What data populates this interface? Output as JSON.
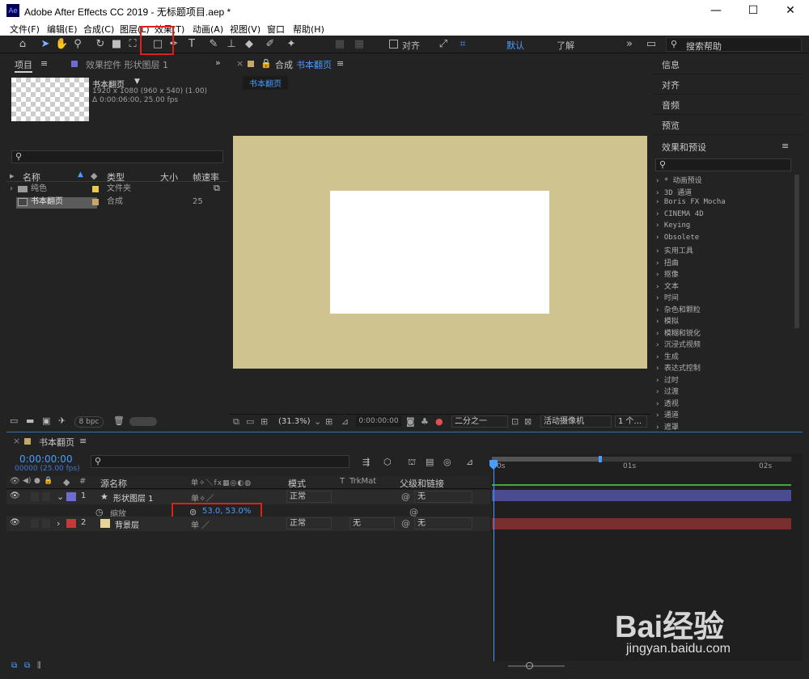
{
  "window": {
    "title": "Adobe After Effects CC 2019 - 无标题项目.aep *",
    "app_logo": "Ae",
    "minimize": "—",
    "maximize": "☐",
    "close": "✕"
  },
  "menu": [
    "文件(F)",
    "编辑(E)",
    "合成(C)",
    "图层(L)",
    "效果(T)",
    "动画(A)",
    "视图(V)",
    "窗口",
    "帮助(H)"
  ],
  "toolbar": {
    "snap_label": "对齐",
    "workspace_default": "默认",
    "workspace_learn": "了解",
    "search_placeholder": "搜索帮助"
  },
  "project": {
    "tab": "项目",
    "effects_tab": "效果控件 形状图层 1",
    "comp_name": "书本翻页",
    "comp_res": "1920 x 1080 (960 x 540) (1.00)",
    "comp_dur": "Δ 0:00:06:00, 25.00 fps",
    "search_placeholder": "",
    "headers": {
      "name": "名称",
      "type": "类型",
      "size": "大小",
      "fps": "帧速率"
    },
    "items": [
      {
        "name": "纯色",
        "type": "文件夹",
        "fps": "",
        "color": "#e6c84a"
      },
      {
        "name": "书本翻页",
        "type": "合成",
        "fps": "25",
        "color": "#c4a96b"
      }
    ],
    "bpc": "8 bpc"
  },
  "composition": {
    "tab": "合成",
    "tab_name": "书本翻页",
    "crumb": "书本翻页",
    "bg_color": "#cfc38f",
    "zoom": "(31.3%)",
    "timecode": "0:00:00:00",
    "resolution": "二分之一",
    "camera": "活动摄像机",
    "views": "1 个..."
  },
  "right": {
    "panels": [
      "信息",
      "对齐",
      "音频",
      "预览"
    ],
    "effects_title": "效果和预设",
    "effects": [
      "* 动画预设",
      "3D 通道",
      "Boris FX Mocha",
      "CINEMA 4D",
      "Keying",
      "Obsolete",
      "实用工具",
      "扭曲",
      "抠像",
      "文本",
      "时间",
      "杂色和颗粒",
      "模拟",
      "模糊和锐化",
      "沉浸式视频",
      "生成",
      "表达式控制",
      "过时",
      "过渡",
      "透视",
      "通道",
      "遮罩"
    ]
  },
  "timeline": {
    "tab": "书本翻页",
    "timecode": "0:00:00:00",
    "frames": "00000 (25.00 fps)",
    "headers": {
      "num": "#",
      "source": "源名称",
      "mode": "模式",
      "t": "T",
      "trkmat": "TrkMat",
      "parent": "父级和链接"
    },
    "ruler": [
      "0s",
      "01s",
      "02s"
    ],
    "layers": [
      {
        "num": "1",
        "name": "形状图层 1",
        "mode": "正常",
        "trkmat": "",
        "parent": "无",
        "color": "#6d6dd1"
      },
      {
        "num": "2",
        "name": "背景层",
        "mode": "正常",
        "trkmat": "无",
        "parent": "无",
        "color": "#c23a3a"
      }
    ],
    "scale_label": "缩放",
    "scale_value": "53.0, 53.0%"
  },
  "watermark": {
    "brand": "Bai经验",
    "url": "jingyan.baidu.com"
  }
}
